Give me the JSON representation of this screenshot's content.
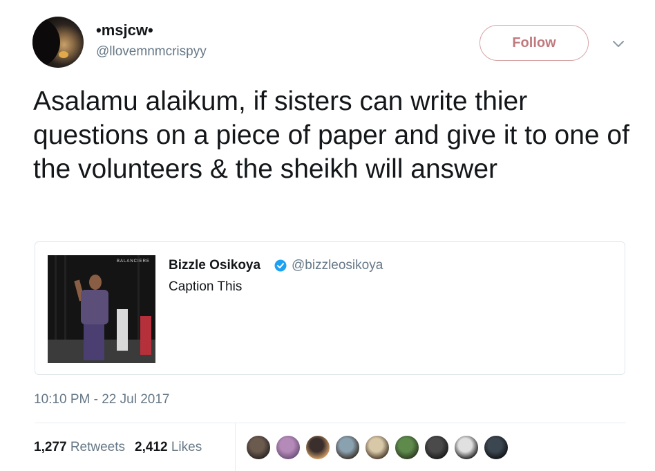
{
  "author": {
    "display_name": "•msjcw•",
    "handle": "@llovemnmcrispyy"
  },
  "follow_label": "Follow",
  "tweet_text": "Asalamu alaikum, if sisters can write thier questions on a piece of paper and give it to one of the volunteers & the sheikh will answer",
  "quoted_tweet": {
    "image_brand_text": "BALANCIERE",
    "display_name": "Bizzle Osikoya",
    "handle": "@bizzleosikoya",
    "text": "Caption This",
    "verified": true
  },
  "timestamp": "10:10 PM - 22 Jul 2017",
  "stats": {
    "retweets_count": "1,277",
    "retweets_label": "Retweets",
    "likes_count": "2,412",
    "likes_label": "Likes"
  },
  "colors": {
    "text": "#14171a",
    "secondary": "#657786",
    "follow_border": "#d7a3a6",
    "follow_text": "#c07a7e",
    "verified": "#1da1f2",
    "border": "#e1e8ed"
  },
  "liker_avatars": [
    {
      "colors": [
        "#6b5a4e",
        "#2a2522"
      ]
    },
    {
      "colors": [
        "#b48ab8",
        "#6e4f7a"
      ]
    },
    {
      "colors": [
        "#3a2f2c",
        "#d9a36b"
      ]
    },
    {
      "colors": [
        "#8aa1b0",
        "#3b3128"
      ]
    },
    {
      "colors": [
        "#d8c8a8",
        "#4a3a2a"
      ]
    },
    {
      "colors": [
        "#5e8a4c",
        "#2d3a22"
      ]
    },
    {
      "colors": [
        "#4a4a4a",
        "#1a1a1a"
      ]
    },
    {
      "colors": [
        "#e0e0e0",
        "#202020"
      ]
    },
    {
      "colors": [
        "#3c4650",
        "#121417"
      ]
    }
  ]
}
